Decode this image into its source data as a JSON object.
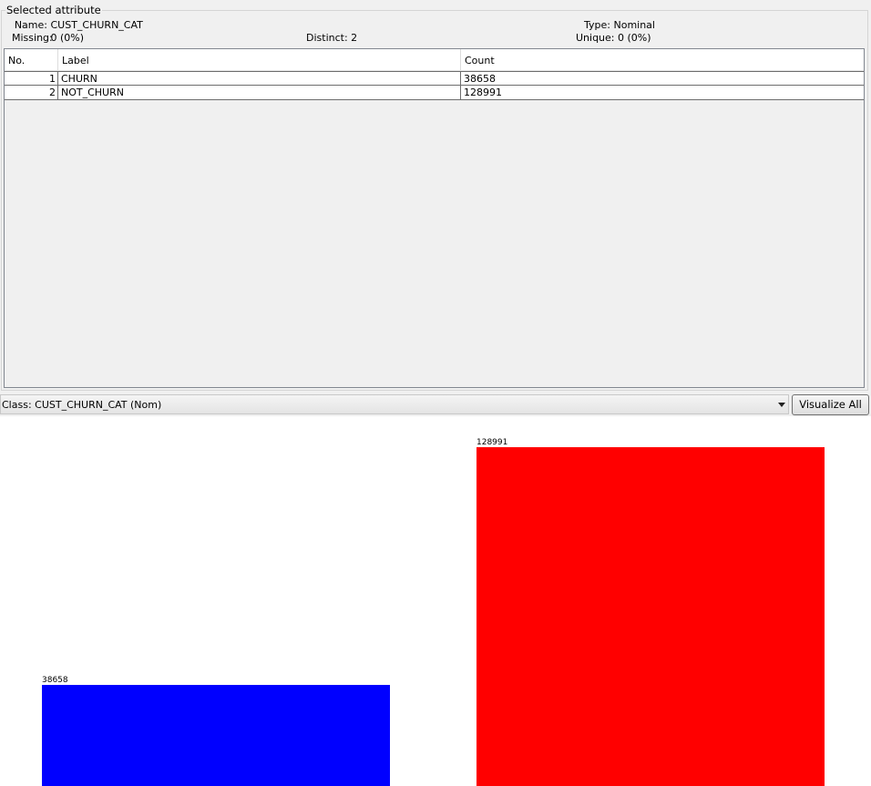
{
  "panel": {
    "title": "Selected attribute",
    "name_label": "Name:",
    "name_value": "CUST_CHURN_CAT",
    "type_label": "Type:",
    "type_value": "Nominal",
    "missing_label": "Missing:",
    "missing_value": "0 (0%)",
    "distinct_label": "Distinct:",
    "distinct_value": "2",
    "unique_label": "Unique:",
    "unique_value": "0 (0%)"
  },
  "table": {
    "headers": [
      "No.",
      "Label",
      "Count"
    ],
    "rows": [
      {
        "no": "1",
        "label": "CHURN",
        "count": "38658"
      },
      {
        "no": "2",
        "label": "NOT_CHURN",
        "count": "128991"
      }
    ]
  },
  "class_selector": {
    "value": "Class: CUST_CHURN_CAT (Nom)"
  },
  "visualize_button": {
    "label": "Visualize All"
  },
  "chart_data": {
    "type": "bar",
    "categories": [
      "CHURN",
      "NOT_CHURN"
    ],
    "values": [
      38658,
      128991
    ],
    "data_labels": [
      "38658",
      "128991"
    ],
    "colors": [
      "#0000ff",
      "#ff0000"
    ]
  }
}
